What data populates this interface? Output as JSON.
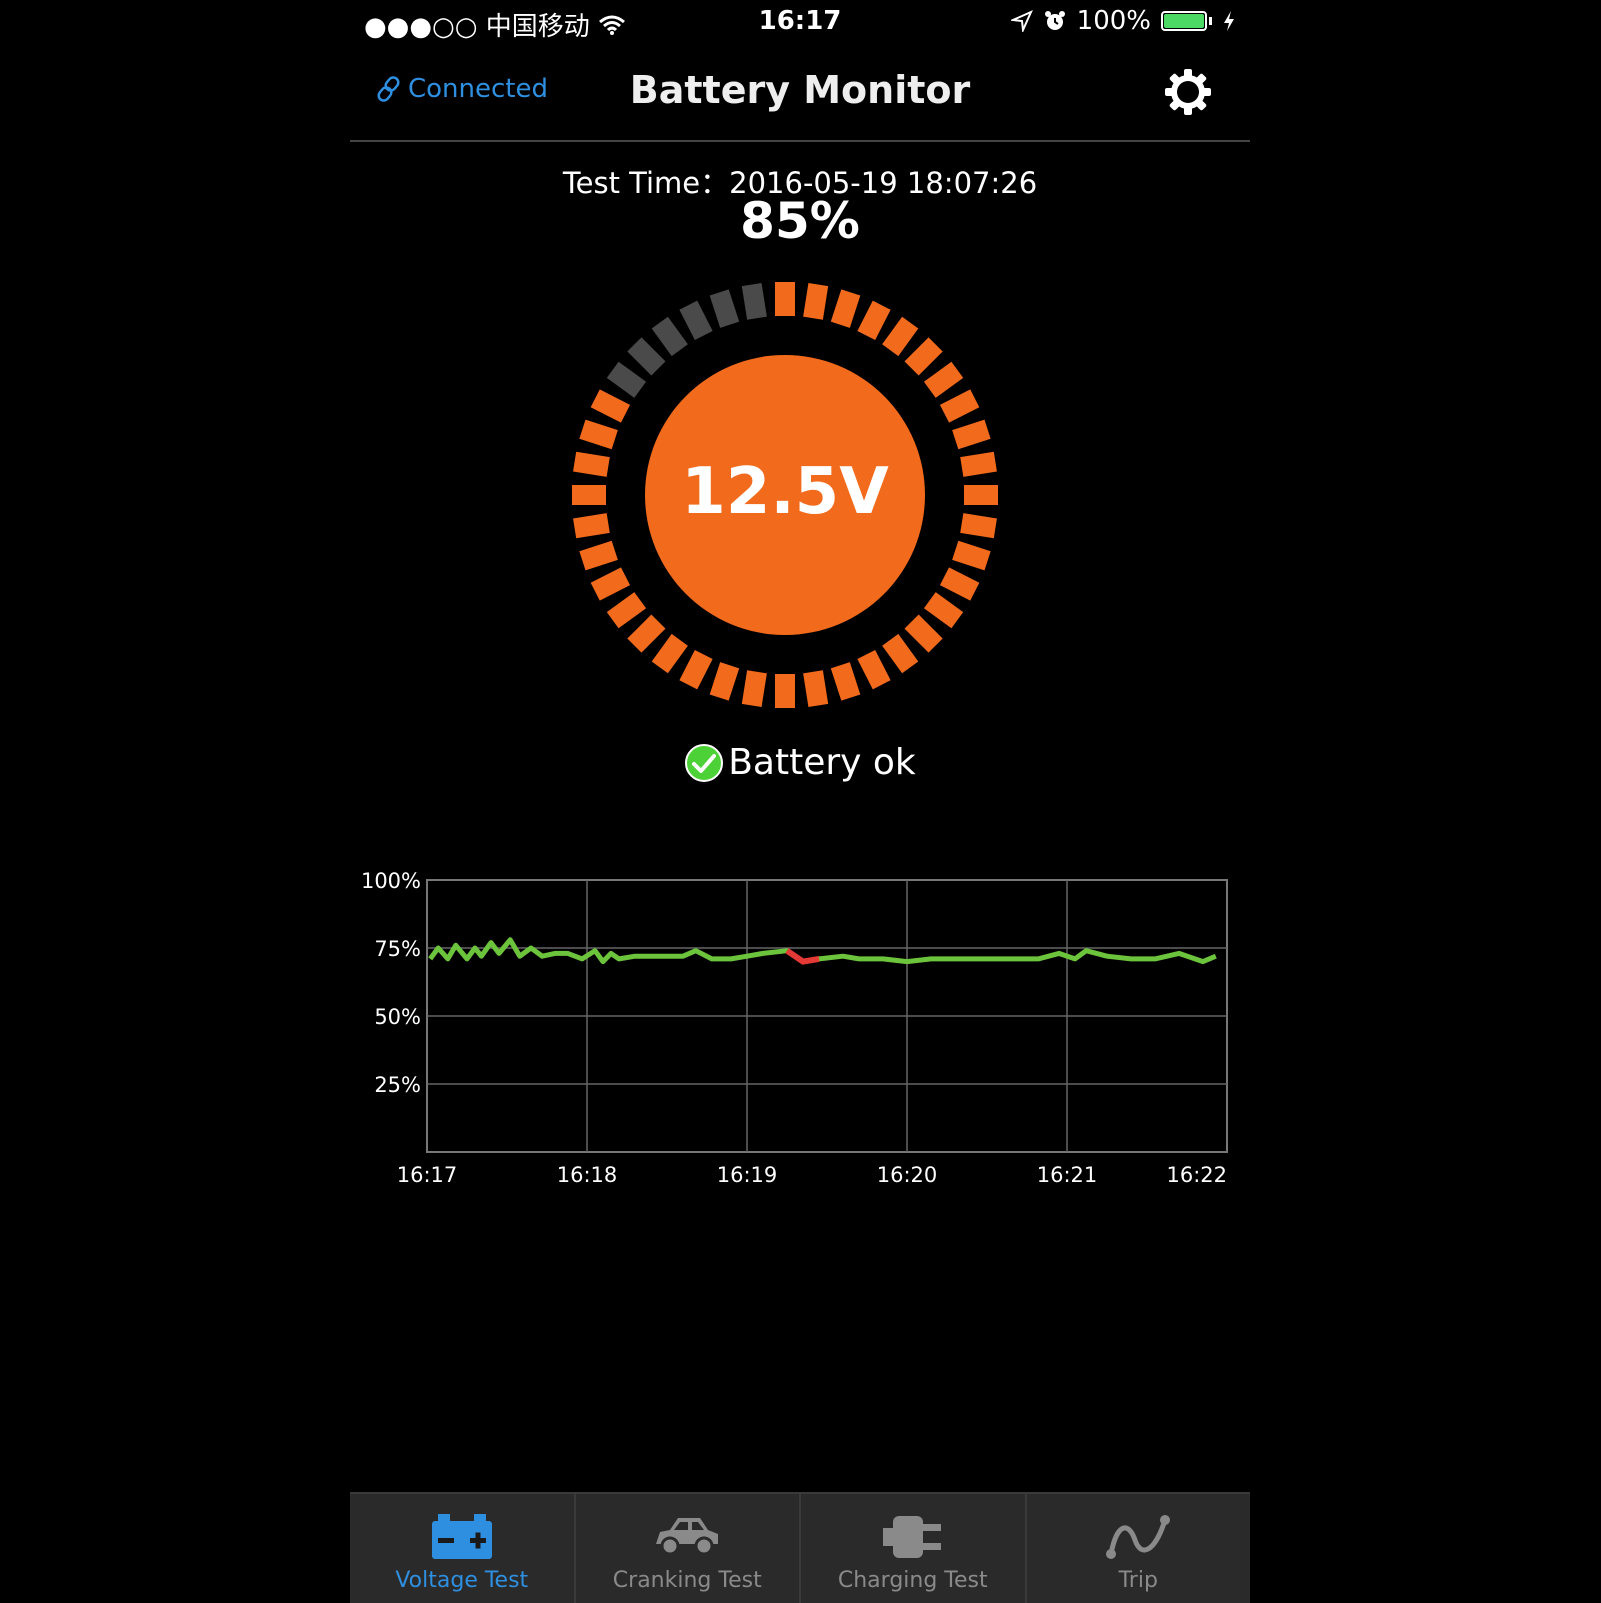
{
  "status_bar": {
    "carrier": "●●●○○ 中国移动",
    "time": "16:17",
    "battery": "100%"
  },
  "nav": {
    "connected_label": "Connected",
    "title": "Battery Monitor",
    "settings_icon": "gear-icon"
  },
  "reading": {
    "test_time": "Test Time：2016-05-19 18:07:26",
    "percent": "85%",
    "voltage": "12.5V",
    "status": "Battery ok",
    "gauge_fraction": 0.85
  },
  "colors": {
    "accent": "#2e8fe0",
    "gauge_orange": "#f26a1b",
    "gauge_gray": "#4a4a4a",
    "ok_green": "#4cd137",
    "line_green": "#6cc33c",
    "warn_red": "#e53935"
  },
  "chart_data": {
    "type": "line",
    "title": "",
    "xlabel": "",
    "ylabel": "",
    "x_ticks": [
      "16:17",
      "16:18",
      "16:19",
      "16:20",
      "16:21",
      "16:22"
    ],
    "y_ticks": [
      "100%",
      "75%",
      "50%",
      "25%"
    ],
    "ylim": [
      0,
      100
    ],
    "xlim": [
      0,
      5
    ],
    "grid": true,
    "series": [
      {
        "values": [
          [
            0.02,
            71
          ],
          [
            0.07,
            75
          ],
          [
            0.13,
            71
          ],
          [
            0.18,
            76
          ],
          [
            0.25,
            71
          ],
          [
            0.3,
            75
          ],
          [
            0.34,
            72
          ],
          [
            0.4,
            77
          ],
          [
            0.45,
            73
          ],
          [
            0.52,
            78
          ],
          [
            0.58,
            72
          ],
          [
            0.65,
            75
          ],
          [
            0.72,
            72
          ],
          [
            0.8,
            73
          ],
          [
            0.88,
            73
          ],
          [
            0.97,
            71
          ],
          [
            1.05,
            74
          ],
          [
            1.1,
            70
          ],
          [
            1.15,
            73
          ],
          [
            1.2,
            71
          ],
          [
            1.3,
            72
          ],
          [
            1.45,
            72
          ],
          [
            1.6,
            72
          ],
          [
            1.68,
            74
          ],
          [
            1.78,
            71
          ],
          [
            1.9,
            71
          ],
          [
            2.0,
            72
          ],
          [
            2.1,
            73
          ],
          [
            2.25,
            74
          ],
          [
            2.35,
            70
          ],
          [
            2.45,
            71
          ],
          [
            2.6,
            72
          ],
          [
            2.7,
            71
          ],
          [
            2.85,
            71
          ],
          [
            3.0,
            70
          ],
          [
            3.15,
            71
          ],
          [
            3.3,
            71
          ],
          [
            3.5,
            71
          ],
          [
            3.7,
            71
          ],
          [
            3.82,
            71
          ],
          [
            3.95,
            73
          ],
          [
            4.05,
            71
          ],
          [
            4.12,
            74
          ],
          [
            4.25,
            72
          ],
          [
            4.4,
            71
          ],
          [
            4.55,
            71
          ],
          [
            4.7,
            73
          ],
          [
            4.85,
            70
          ],
          [
            4.93,
            72
          ]
        ]
      }
    ],
    "highlight": {
      "x_start": 2.3,
      "x_end": 2.4
    }
  },
  "tabs": [
    {
      "label": "Voltage Test",
      "icon": "battery-icon",
      "active": true
    },
    {
      "label": "Cranking Test",
      "icon": "car-icon",
      "active": false
    },
    {
      "label": "Charging Test",
      "icon": "plug-icon",
      "active": false
    },
    {
      "label": "Trip",
      "icon": "route-icon",
      "active": false
    }
  ]
}
